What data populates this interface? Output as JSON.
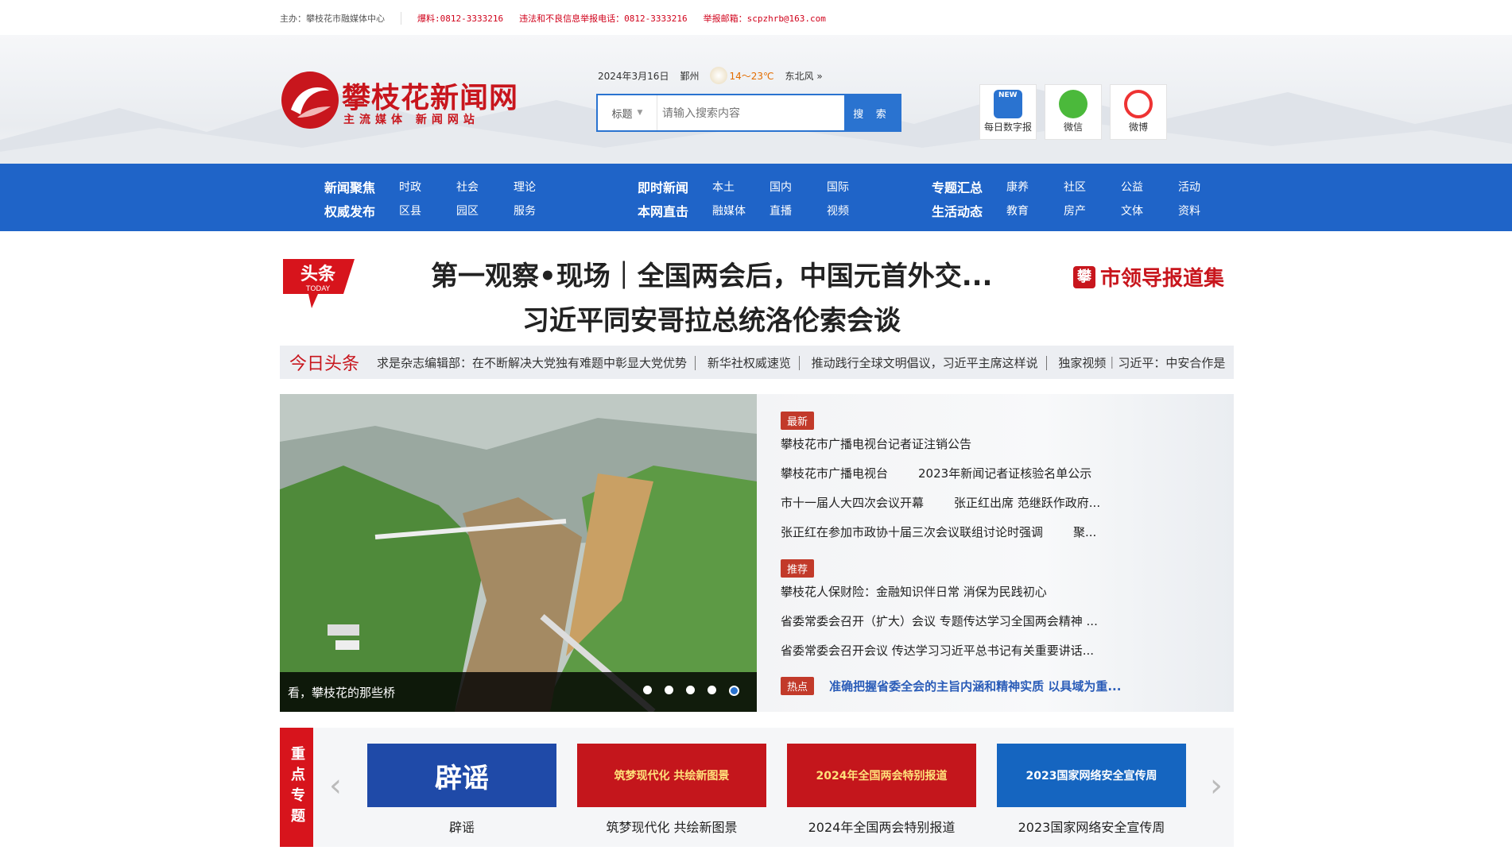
{
  "topbar": {
    "host": "主办：攀枝花市融媒体中心",
    "hotline": "爆料:0812-3333216",
    "report_phone": "违法和不良信息举报电话：0812-3333216",
    "report_email": "举报邮箱：scpzhrb@163.com"
  },
  "header": {
    "logo_title": "攀枝花新闻网",
    "logo_sub": "主流媒体 新闻网站",
    "date": "2024年3月16日",
    "city": "鄞州",
    "temp": "14～23℃",
    "wind": "东北风",
    "wind_more": "»",
    "search_type": "标题",
    "search_placeholder": "请输入搜索内容",
    "search_button": "搜 索",
    "apps": [
      {
        "label": "每日数字报",
        "icon": "digital-paper-icon"
      },
      {
        "label": "微信",
        "icon": "wechat-icon"
      },
      {
        "label": "微博",
        "icon": "weibo-icon"
      }
    ]
  },
  "nav": {
    "row1": [
      {
        "head": "新闻聚焦",
        "items": [
          "时政",
          "社会",
          "理论"
        ]
      },
      {
        "head": "即时新闻",
        "items": [
          "本土",
          "国内",
          "国际"
        ]
      },
      {
        "head": "专题汇总",
        "items": [
          "康养",
          "社区",
          "公益",
          "活动"
        ]
      }
    ],
    "row2": [
      {
        "head": "权威发布",
        "items": [
          "区县",
          "园区",
          "服务"
        ]
      },
      {
        "head": "本网直击",
        "items": [
          "融媒体",
          "直播",
          "视频"
        ]
      },
      {
        "head": "生活动态",
        "items": [
          "教育",
          "房产",
          "文体",
          "资料"
        ]
      }
    ]
  },
  "headline": {
    "badge_main": "头条",
    "badge_sub": "TODAY",
    "line1": "第一观察•现场｜全国两会后，中国元首外交...",
    "line2": "习近平同安哥拉总统洛伦索会谈",
    "leader": "市领导报道集",
    "leader_mark": "攀"
  },
  "ticker": {
    "label": "今日头条",
    "items": [
      "求是杂志编辑部：在不断解决大党独有难题中彰显大党优势",
      "新华社权威速览",
      "推动践行全球文明倡议，习近平主席这样说",
      "独家视频｜习近平：中安合作是"
    ]
  },
  "slideshow": {
    "caption": "看，攀枝花的那些桥",
    "dots": 5,
    "active_dot": 5
  },
  "news": {
    "latest_tag": "最新",
    "latest": [
      [
        "攀枝花市广播电视台记者证注销公告",
        ""
      ],
      [
        "攀枝花市广播电视台",
        "2023年新闻记者证核验名单公示"
      ],
      [
        "市十一届人大四次会议开幕",
        "张正红出席 范继跃作政府..."
      ],
      [
        "张正红在参加市政协十届三次会议联组讨论时强调",
        "聚..."
      ]
    ],
    "recommend_tag": "推荐",
    "recommend": [
      "攀枝花人保财险：金融知识伴日常 消保为民践初心",
      "省委常委会召开（扩大）会议 专题传达学习全国两会精神 ...",
      "省委常委会召开会议 传达学习习近平总书记有关重要讲话..."
    ],
    "hot_tag": "热点",
    "hot": "准确把握省委全会的主旨内涵和精神实质 以具域为重..."
  },
  "topics": {
    "side_label": "重点专题",
    "prev": "‹",
    "next": "›",
    "cards": [
      {
        "title": "辟谣",
        "banner": "辟谣",
        "bg": "#1f4aa8"
      },
      {
        "title": "筑梦现代化 共绘新图景",
        "banner": "筑梦现代化 共绘新图景",
        "bg": "#c4161c"
      },
      {
        "title": "2024年全国两会特别报道",
        "banner": "2024年全国两会特别报道",
        "bg": "#c4161c"
      },
      {
        "title": "2023国家网络安全宣传周",
        "banner": "2023国家网络安全宣传周",
        "bg": "#1565c0"
      }
    ]
  },
  "colors": {
    "brand_red": "#c8161d",
    "nav_blue": "#1f64c8",
    "accent_blue": "#2a73d0"
  }
}
